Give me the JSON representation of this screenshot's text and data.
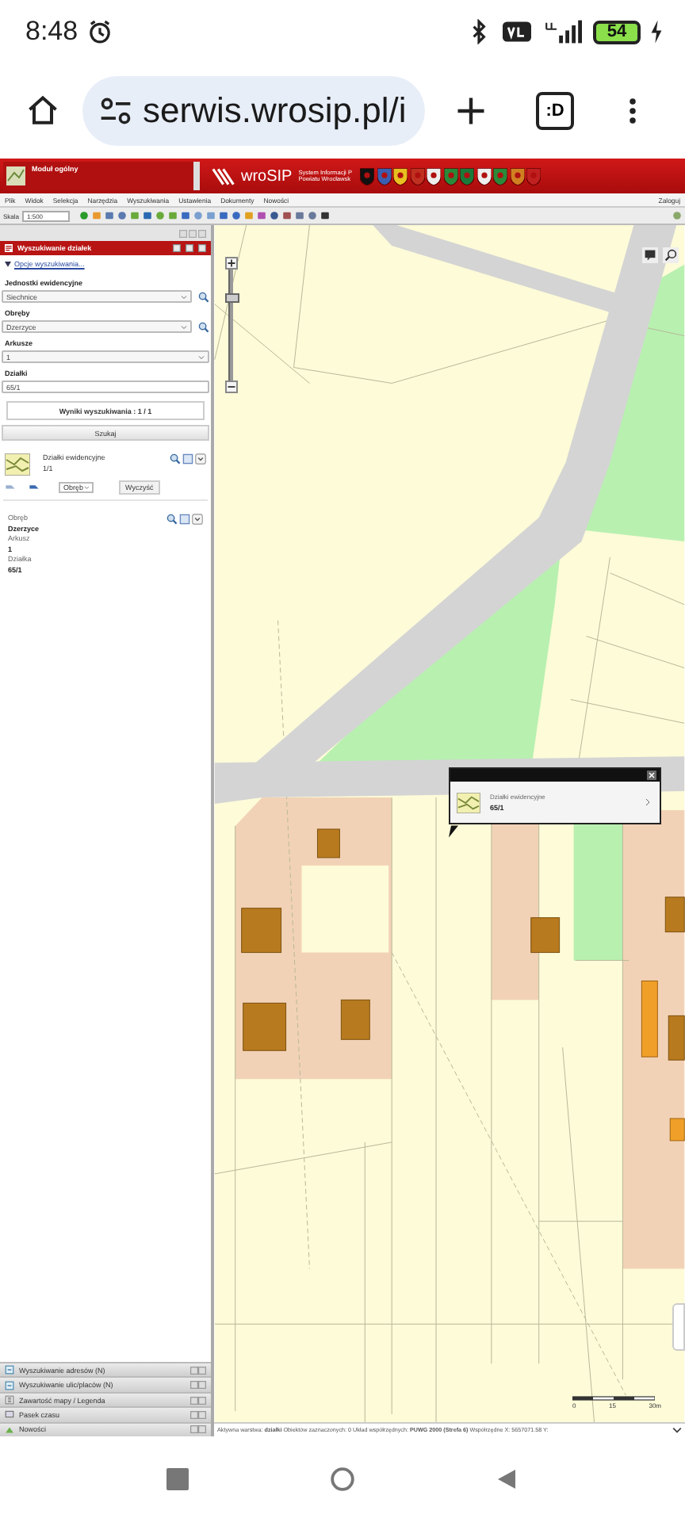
{
  "phone_status": {
    "time": "8:48",
    "battery": "54"
  },
  "browser": {
    "url": "serwis.wrosip.pl/i",
    "tab_label": ":D"
  },
  "app_header": {
    "module": "Moduł ogólny",
    "logo": "wroSIP",
    "subtitle_lines": [
      "System Informacji P",
      "Powiatu Wrocławsk"
    ]
  },
  "menu": [
    "Plik",
    "Widok",
    "Selekcja",
    "Narzędzia",
    "Wyszukiwania",
    "Ustawienia",
    "Dokumenty",
    "Nowości"
  ],
  "login": "Zaloguj",
  "toolbar": {
    "scale_label": "Skala",
    "scale": "1:500"
  },
  "search_panel": {
    "title": "Wyszukiwanie działek",
    "options_link": "Opcje wyszukiwania...",
    "fields": [
      {
        "label": "Jednostki ewidencyjne",
        "kind": "select",
        "value": "Siechnice",
        "search": true
      },
      {
        "label": "Obręby",
        "kind": "select",
        "value": "Dzerzyce",
        "search": true
      },
      {
        "label": "Arkusze",
        "kind": "select",
        "value": "1",
        "search": false
      },
      {
        "label": "Działki",
        "kind": "input",
        "value": "65/1",
        "search": false
      }
    ],
    "results": "Wyniki wyszukiwania : 1 / 1",
    "search_button": "Szukaj",
    "result": {
      "title": "Działki ewidencyjne",
      "count": "1/1",
      "group_select": "Obręb",
      "clear_button": "Wyczyść",
      "details": [
        {
          "label": "Obręb",
          "value": "Dzerzyce"
        },
        {
          "label": "Arkusz",
          "value": "1"
        },
        {
          "label": "Działka",
          "value": "65/1"
        }
      ]
    }
  },
  "accordions": [
    {
      "label": "Wyszukiwanie adresów (N)",
      "kind": "search"
    },
    {
      "label": "Wyszukiwanie ulic/placów (N)",
      "kind": "search"
    },
    {
      "label": "Zawartość mapy / Legenda",
      "kind": "legend"
    },
    {
      "label": "Pasek czasu",
      "kind": "time"
    },
    {
      "label": "Nowości",
      "kind": "news"
    }
  ],
  "map": {
    "zoom": {
      "level": 0.78
    },
    "popup": {
      "title": "Działki ewidencyjne",
      "value": "65/1"
    },
    "scale_labels": [
      "0",
      "15",
      "30m"
    ]
  },
  "map_status": "Aktywna warstwa: **działki**   Obiektów zaznaczonych: 0   Układ współrzędnych: **PUWG 2000 (Strefa 6)**   Współrzędne X: 5657071.58 Y:"
}
